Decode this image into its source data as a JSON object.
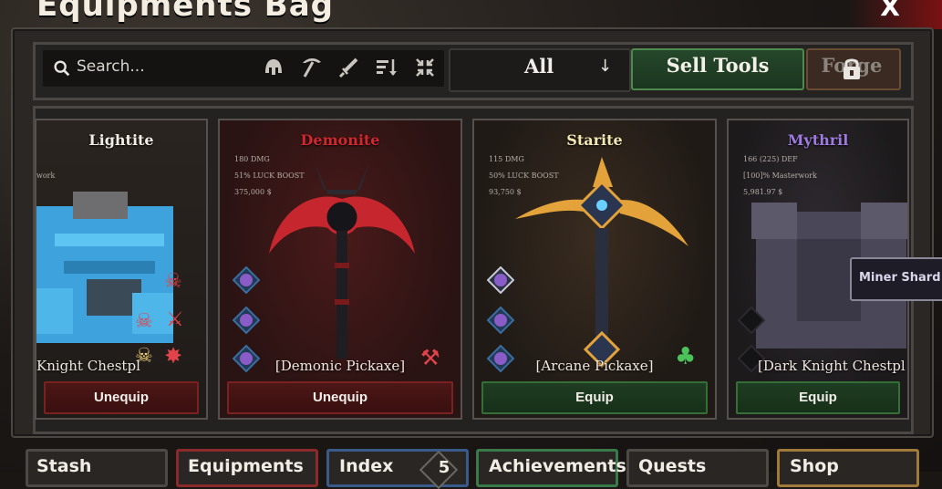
{
  "window": {
    "title": "Equipments Bag",
    "close_label": "X"
  },
  "toolbar": {
    "search_placeholder": "Search...",
    "filter_icons": [
      "helmet-icon",
      "pickaxe-icon",
      "sword-icon",
      "sort-icon",
      "collapse-icon"
    ],
    "dropdown_value": "All",
    "sell_label": "Sell Tools",
    "forge_label": "Forge"
  },
  "cards": [
    {
      "name": "Lightite",
      "name_color": "#f2ede5",
      "stats": [
        "work"
      ],
      "item": "Knight Chestpl",
      "action": "Unequip",
      "action_style": "red"
    },
    {
      "name": "Demonite",
      "name_color": "#d1272e",
      "stats": [
        "180 DMG",
        "51% LUCK BOOST",
        "375,000 $"
      ],
      "item": "[Demonic Pickaxe]",
      "action": "Unequip",
      "action_style": "red"
    },
    {
      "name": "Starite",
      "name_color": "#f3e7b2",
      "stats": [
        "115 DMG",
        "50% LUCK BOOST",
        "93,750 $"
      ],
      "item": "[Arcane Pickaxe]",
      "action": "Equip",
      "action_style": "green"
    },
    {
      "name": "Mythril",
      "name_color": "#9f7be0",
      "stats": [
        "166 (225) DEF",
        "[100]% Masterwork",
        "5,981.97 $"
      ],
      "item": "[Dark Knight Chestpl",
      "action": "Equip",
      "action_style": "green"
    }
  ],
  "tooltip": {
    "text": "Miner Shard [T"
  },
  "tabs": [
    {
      "label": "Stash",
      "border": "#4d4944"
    },
    {
      "label": "Equipments",
      "border": "#8a2a2a"
    },
    {
      "label": "Index",
      "badge": "5",
      "border": "#3a5a8a"
    },
    {
      "label": "Achievements",
      "border": "#3a7a4a"
    },
    {
      "label": "Quests",
      "border": "#4d4944"
    },
    {
      "label": "Shop",
      "border": "#a07a3a"
    }
  ]
}
